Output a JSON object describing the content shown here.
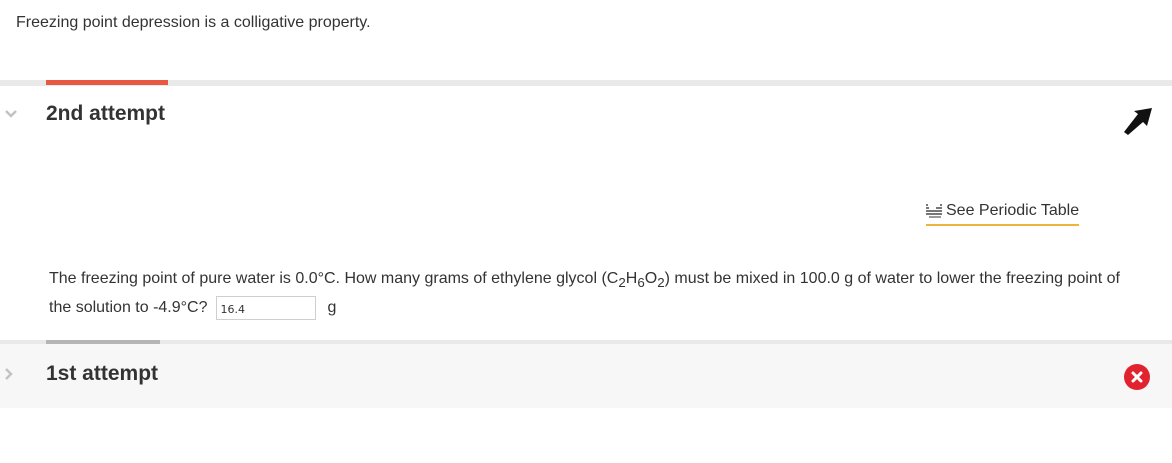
{
  "intro": {
    "text": "Freezing point depression is a colligative property."
  },
  "attempt_current": {
    "title": "2nd attempt",
    "periodic_link": "See Periodic Table",
    "question": {
      "part1": "The freezing point of pure water is 0.0°C. How many grams of ethylene glycol (C",
      "sub1": "2",
      "part2": "H",
      "sub2": "6",
      "part3": "O",
      "sub3": "2",
      "part4": ") must be mixed in 100.0 g of water to lower the freezing point of the solution to -4.9°C?"
    },
    "answer_value": "16.4",
    "unit": "g"
  },
  "attempt_previous": {
    "title": "1st attempt",
    "status": "incorrect"
  },
  "colors": {
    "accent_current": "#e8573f",
    "accent_previous": "#b5b5b5",
    "link_underline": "#f0b43c",
    "error": "#e0232f"
  },
  "icons": {
    "expand_current": "chevron-down-icon",
    "expand_previous": "chevron-right-icon",
    "submit_arrow": "arrow-up-left-icon",
    "periodic": "periodic-table-icon",
    "status_previous": "x-circle-icon"
  }
}
